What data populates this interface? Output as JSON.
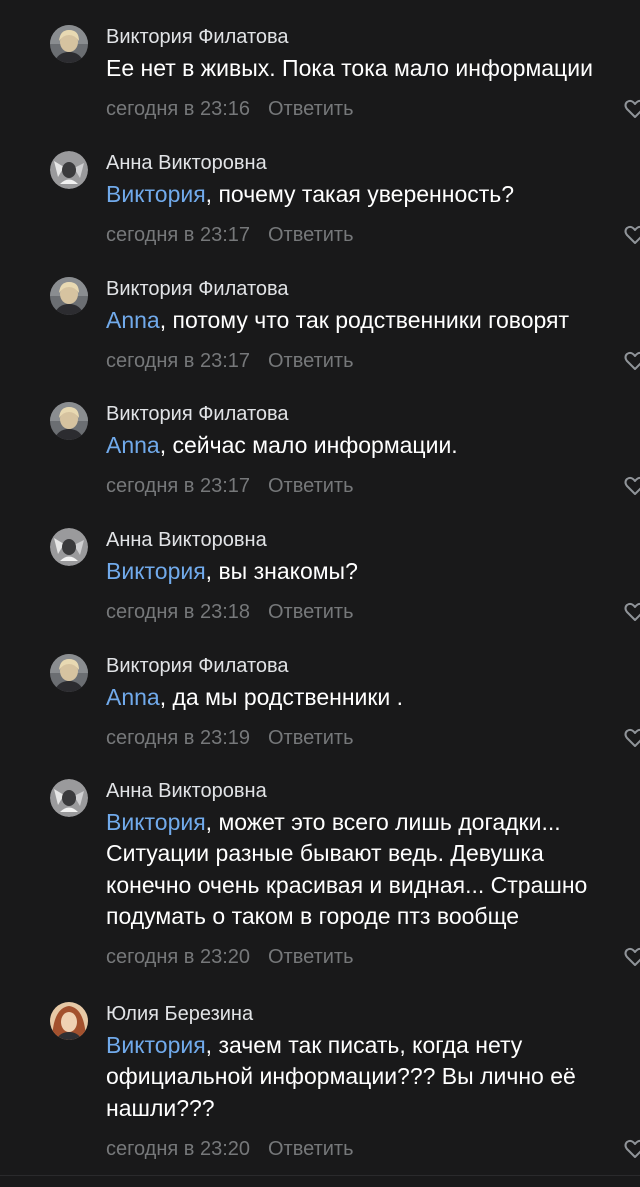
{
  "comments": [
    {
      "author": "Виктория Филатова",
      "avatar": "viktoria",
      "mention": "",
      "text": "Ее нет в живых. Пока тока мало информации",
      "date": "сегодня в 23:16",
      "reply": "Ответить"
    },
    {
      "author": "Анна Викторовна",
      "avatar": "anna",
      "mention": "Виктория",
      "text": ", почему такая уверенность?",
      "date": "сегодня в 23:17",
      "reply": "Ответить"
    },
    {
      "author": "Виктория Филатова",
      "avatar": "viktoria",
      "mention": "Anna",
      "text": ", потому что так родственники говорят",
      "date": "сегодня в 23:17",
      "reply": "Ответить"
    },
    {
      "author": "Виктория Филатова",
      "avatar": "viktoria",
      "mention": "Anna",
      "text": ", сейчас мало информации.",
      "date": "сегодня в 23:17",
      "reply": "Ответить"
    },
    {
      "author": "Анна Викторовна",
      "avatar": "anna",
      "mention": "Виктория",
      "text": ", вы знакомы?",
      "date": "сегодня в 23:18",
      "reply": "Ответить"
    },
    {
      "author": "Виктория Филатова",
      "avatar": "viktoria",
      "mention": "Anna",
      "text": ", да мы родственники .",
      "date": "сегодня в 23:19",
      "reply": "Ответить"
    },
    {
      "author": "Анна Викторовна",
      "avatar": "anna",
      "mention": "Виктория",
      "text": ", может это всего лишь догадки...\nСитуации разные бывают ведь. Девушка\nконечно очень красивая и видная... Страшно\nподумать о таком в городе птз вообще",
      "date": "сегодня в 23:20",
      "reply": "Ответить"
    },
    {
      "author": "Юлия Березина",
      "avatar": "yulia",
      "mention": "Виктория",
      "text": ", зачем так писать, когда нету\nофициальной информации??? Вы лично её\nнашли???",
      "date": "сегодня в 23:20",
      "reply": "Ответить"
    }
  ],
  "colors": {
    "background": "#19191a",
    "author": "#e1e3e6",
    "text": "#ffffff",
    "mention": "#71aaeb",
    "meta": "#76787a"
  },
  "icons": {
    "like": "heart-outline-icon"
  }
}
